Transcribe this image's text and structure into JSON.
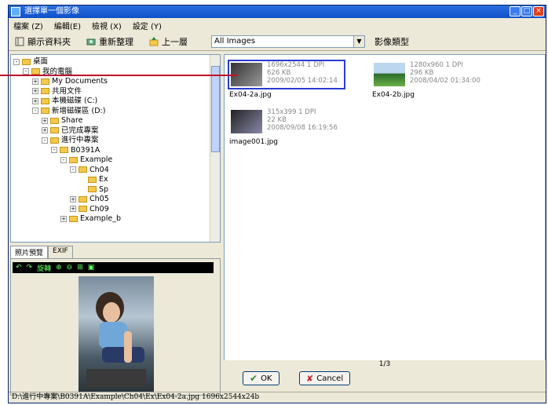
{
  "window": {
    "title": "選擇單一個影像",
    "controls": [
      "_",
      "□",
      "×"
    ]
  },
  "menu": [
    {
      "label": "檔案 (Z)"
    },
    {
      "label": "編輯(E)"
    },
    {
      "label": "檢視 (X)"
    },
    {
      "label": "設定 (Y)"
    }
  ],
  "toolbar": {
    "show_folders": "顯示資料夾",
    "refresh": "重新整理",
    "up_level": "上一層",
    "filter_value": "All Images",
    "filter_label": "影像類型"
  },
  "tree": [
    {
      "label": "桌面",
      "level": 0,
      "exp": "-"
    },
    {
      "label": "我的電腦",
      "level": 1,
      "exp": "-"
    },
    {
      "label": "My Documents",
      "level": 2,
      "exp": "+"
    },
    {
      "label": "共用文件",
      "level": 2,
      "exp": "+"
    },
    {
      "label": "本機磁碟 (C:)",
      "level": 2,
      "exp": "+"
    },
    {
      "label": "新增磁碟區 (D:)",
      "level": 2,
      "exp": "-"
    },
    {
      "label": "Share",
      "level": 3,
      "exp": "+"
    },
    {
      "label": "已完成專案",
      "level": 3,
      "exp": "+"
    },
    {
      "label": "進行中專案",
      "level": 3,
      "exp": "-"
    },
    {
      "label": "B0391A",
      "level": 4,
      "exp": "-"
    },
    {
      "label": "Example",
      "level": 5,
      "exp": "-"
    },
    {
      "label": "Ch04",
      "level": 6,
      "exp": "-"
    },
    {
      "label": "Ex",
      "level": 7,
      "exp": ""
    },
    {
      "label": "Sp",
      "level": 7,
      "exp": ""
    },
    {
      "label": "Ch05",
      "level": 6,
      "exp": "+"
    },
    {
      "label": "Ch09",
      "level": 6,
      "exp": "+"
    },
    {
      "label": "Example_b",
      "level": 5,
      "exp": "+"
    }
  ],
  "preview_tabs": [
    {
      "label": "照片預覽"
    },
    {
      "label": "EXIF"
    }
  ],
  "preview_toolbar": {
    "rotate_label": "旋轉"
  },
  "thumbnails": [
    {
      "name": "Ex04-2a.jpg",
      "dims": "1696x2544 1 DPI",
      "size": "626 KB",
      "date": "2009/02/05 14:02:14",
      "selected": true
    },
    {
      "name": "Ex04-2b.jpg",
      "dims": "1280x960 1 DPI",
      "size": "296 KB",
      "date": "2008/04/02 01:34:00",
      "selected": false
    },
    {
      "name": "image001.jpg",
      "dims": "315x399 1 DPI",
      "size": "22 KB",
      "date": "2008/09/08 16:19:56",
      "selected": false
    }
  ],
  "page_indicator": "1/3",
  "buttons": {
    "ok": "OK",
    "cancel": "Cancel"
  },
  "status": "D:\\進行中專案\\B0391A\\Example\\Ch04\\Ex\\Ex04-2a.jpg   1696x2544x24b",
  "colors": {
    "accent": "#2a3cd0",
    "callout": "#c0102a",
    "titlebar": "#1050c8"
  }
}
